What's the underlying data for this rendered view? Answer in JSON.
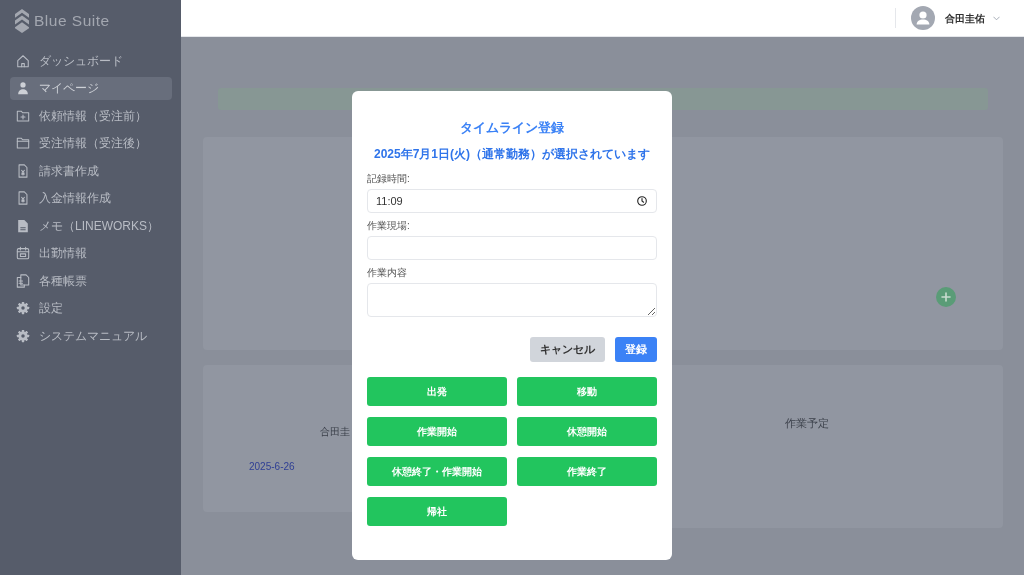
{
  "sidebar": {
    "logo": "Blue Suite",
    "items": [
      {
        "label": "ダッシュボード",
        "selected": false
      },
      {
        "label": "マイページ",
        "selected": true
      },
      {
        "label": "依頼情報（受注前）",
        "selected": false
      },
      {
        "label": "受注情報（受注後）",
        "selected": false
      },
      {
        "label": "請求書作成",
        "selected": false
      },
      {
        "label": "入金情報作成",
        "selected": false
      },
      {
        "label": "メモ（LINEWORKS）",
        "selected": false
      },
      {
        "label": "出勤情報",
        "selected": false
      },
      {
        "label": "各種帳票",
        "selected": false
      },
      {
        "label": "設定",
        "selected": false
      },
      {
        "label": "システムマニュアル",
        "selected": false
      }
    ]
  },
  "topbar": {
    "user_name": "合田圭佑"
  },
  "page": {
    "employee_name": "合田圭",
    "date": "2025-6-26",
    "schedule_heading": "作業予定"
  },
  "modal": {
    "title": "タイムライン登録",
    "subtitle": "2025年7月1日(火)（通常勤務）が選択されています",
    "fields": [
      {
        "kind": "time",
        "label": "記録時間:",
        "value": "11:09"
      },
      {
        "kind": "text",
        "label": "作業現場:"
      },
      {
        "kind": "textarea",
        "label": "作業内容"
      }
    ],
    "buttons": [
      {
        "kind": "secondary",
        "label": "キャンセル"
      },
      {
        "kind": "primary",
        "label": "登録"
      }
    ],
    "action_buttons": [
      "出発",
      "移動",
      "作業開始",
      "休憩開始",
      "休憩終了・作業開始",
      "作業終了",
      "帰社"
    ]
  }
}
